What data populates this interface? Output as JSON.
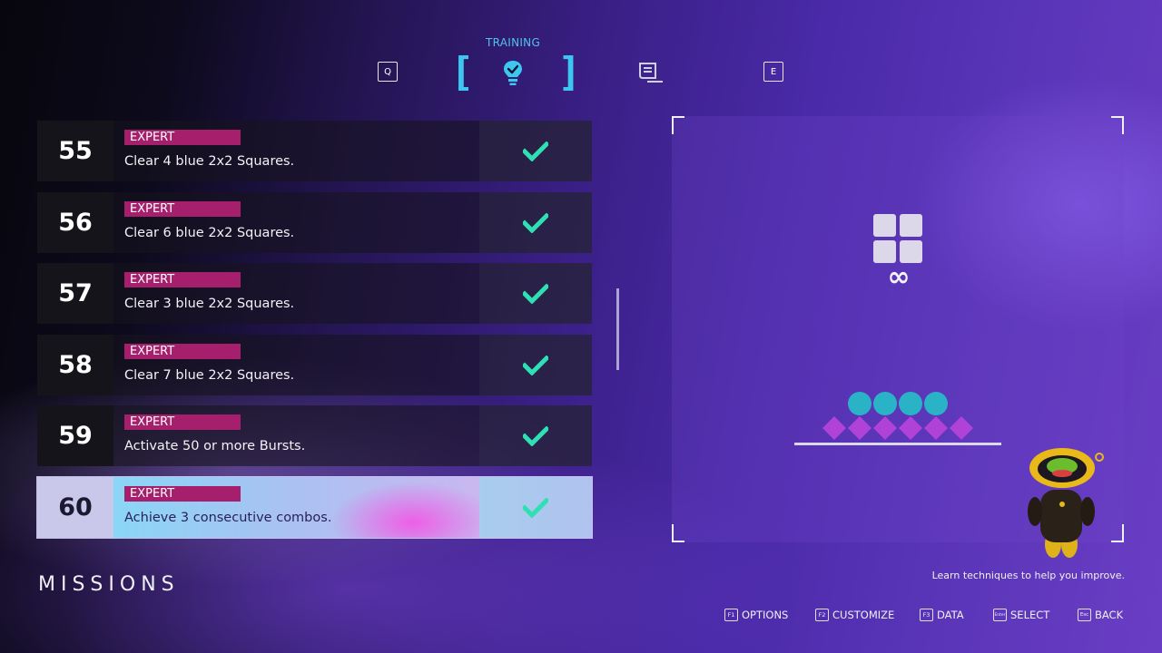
{
  "header": {
    "active_tab_label": "TRAINING",
    "left_key": "Q",
    "right_key": "E",
    "tabs": [
      {
        "icon": "lightbulb-icon",
        "active": true
      },
      {
        "icon": "scroll-icon",
        "active": false
      }
    ]
  },
  "missions": [
    {
      "number": "55",
      "difficulty": "EXPERT",
      "description": "Clear 4 blue 2x2 Squares.",
      "completed": true
    },
    {
      "number": "56",
      "difficulty": "EXPERT",
      "description": "Clear 6 blue 2x2 Squares.",
      "completed": true
    },
    {
      "number": "57",
      "difficulty": "EXPERT",
      "description": "Clear 3 blue 2x2 Squares.",
      "completed": true
    },
    {
      "number": "58",
      "difficulty": "EXPERT",
      "description": "Clear 7 blue 2x2 Squares.",
      "completed": true
    },
    {
      "number": "59",
      "difficulty": "EXPERT",
      "description": "Activate 50 or more Bursts.",
      "completed": true
    },
    {
      "number": "60",
      "difficulty": "EXPERT",
      "description": "Achieve 3 consecutive combos.",
      "completed": true,
      "selected": true
    }
  ],
  "section_title": "MISSIONS",
  "preview": {
    "infinity_symbol": "∞",
    "hint": "Learn techniques to help you improve."
  },
  "footer": [
    {
      "key": "F1",
      "label": "OPTIONS"
    },
    {
      "key": "F2",
      "label": "CUSTOMIZE"
    },
    {
      "key": "F3",
      "label": "DATA"
    },
    {
      "key": "Enter",
      "label": "SELECT"
    },
    {
      "key": "Esc",
      "label": "BACK"
    }
  ],
  "colors": {
    "accent": "#3cc6f0",
    "badge": "#a51f6d",
    "check": "#2ee0b4",
    "block": "#dcd8ea",
    "circle": "#2ab3c6",
    "diamond": "#b042d8"
  }
}
